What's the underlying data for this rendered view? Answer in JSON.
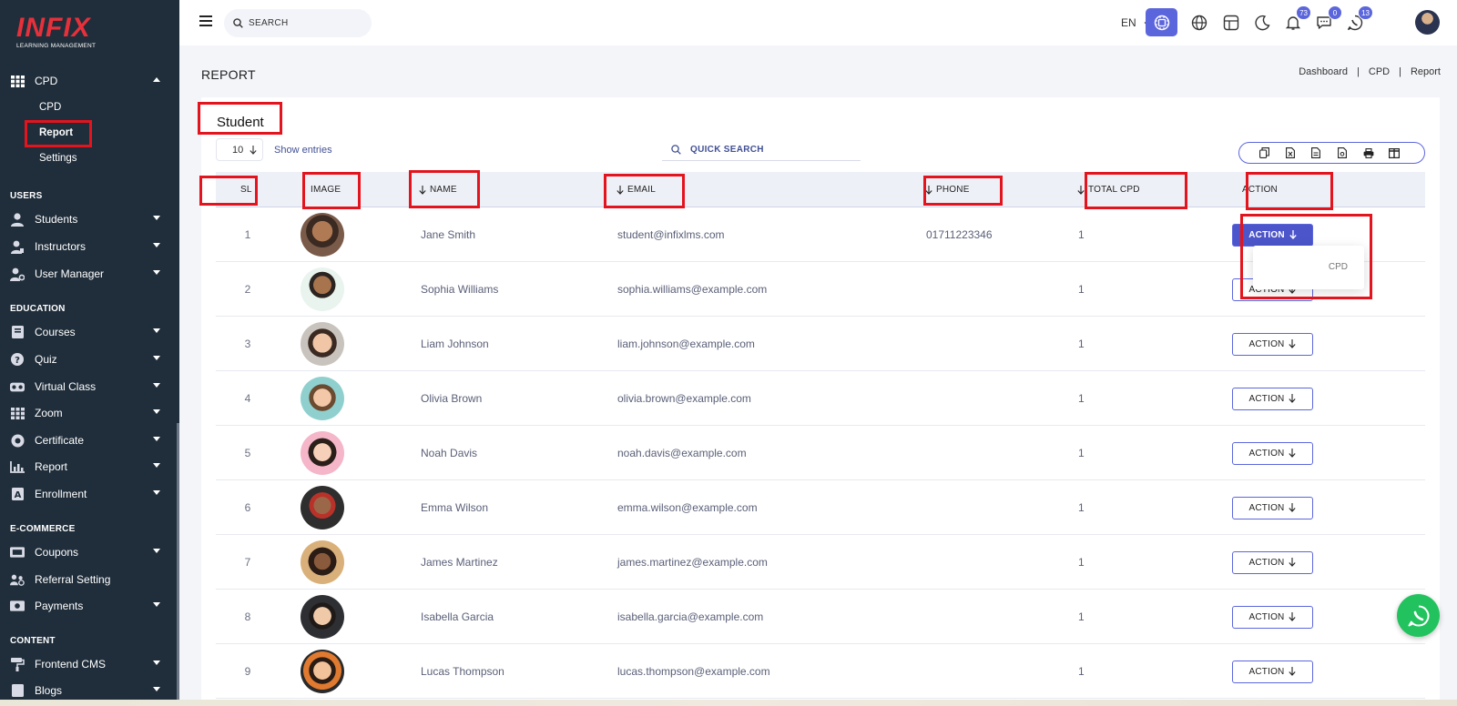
{
  "brand": {
    "name": "INFIX",
    "tagline": "LEARNING MANAGEMENT",
    "accent": "#e8303a",
    "primary": "#5c66dc"
  },
  "sidebar": {
    "open_group": {
      "label": "CPD",
      "icon": "grid-icon"
    },
    "open_group_subitems": [
      {
        "label": "CPD"
      },
      {
        "label": "Report",
        "active": true
      },
      {
        "label": "Settings"
      }
    ],
    "sections": [
      {
        "title": "USERS",
        "items": [
          {
            "label": "Students",
            "icon": "user-icon"
          },
          {
            "label": "Instructors",
            "icon": "instructor-icon"
          },
          {
            "label": "User Manager",
            "icon": "user-gear-icon"
          }
        ]
      },
      {
        "title": "EDUCATION",
        "items": [
          {
            "label": "Courses",
            "icon": "book-icon"
          },
          {
            "label": "Quiz",
            "icon": "question-icon"
          },
          {
            "label": "Virtual Class",
            "icon": "vr-icon"
          },
          {
            "label": "Zoom",
            "icon": "grid-icon"
          },
          {
            "label": "Certificate",
            "icon": "certificate-icon"
          },
          {
            "label": "Report",
            "icon": "chart-icon"
          },
          {
            "label": "Enrollment",
            "icon": "enroll-icon"
          }
        ]
      },
      {
        "title": "E-COMMERCE",
        "items": [
          {
            "label": "Coupons",
            "icon": "coupon-icon"
          },
          {
            "label": "Referral Setting",
            "icon": "referral-icon"
          },
          {
            "label": "Payments",
            "icon": "payment-icon"
          }
        ]
      },
      {
        "title": "CONTENT",
        "items": [
          {
            "label": "Frontend CMS",
            "icon": "paint-roller-icon"
          },
          {
            "label": "Blogs",
            "icon": "blog-icon"
          }
        ]
      }
    ]
  },
  "topbar": {
    "search_placeholder": "SEARCH",
    "language": "EN",
    "badges": {
      "notifications": "73",
      "messages": "0",
      "whatsapp": "13"
    }
  },
  "page": {
    "title": "REPORT",
    "breadcrumb": [
      "Dashboard",
      "CPD",
      "Report"
    ]
  },
  "card": {
    "title": "Student",
    "entries_value": "10",
    "entries_label": "Show entries",
    "quick_search_placeholder": "QUICK SEARCH"
  },
  "table": {
    "headers": {
      "sl": "SL",
      "image": "IMAGE",
      "name": "NAME",
      "email": "EMAIL",
      "phone": "PHONE",
      "total_cpd": "TOTAL CPD",
      "action": "ACTION"
    },
    "action_label": "ACTION",
    "dropdown_option": "CPD",
    "rows": [
      {
        "sl": "1",
        "name": "Jane Smith",
        "email": "student@infixlms.com",
        "phone": "01711223346",
        "total_cpd": "1"
      },
      {
        "sl": "2",
        "name": "Sophia Williams",
        "email": "sophia.williams@example.com",
        "phone": "",
        "total_cpd": "1"
      },
      {
        "sl": "3",
        "name": "Liam Johnson",
        "email": "liam.johnson@example.com",
        "phone": "",
        "total_cpd": "1"
      },
      {
        "sl": "4",
        "name": "Olivia Brown",
        "email": "olivia.brown@example.com",
        "phone": "",
        "total_cpd": "1"
      },
      {
        "sl": "5",
        "name": "Noah Davis",
        "email": "noah.davis@example.com",
        "phone": "",
        "total_cpd": "1"
      },
      {
        "sl": "6",
        "name": "Emma Wilson",
        "email": "emma.wilson@example.com",
        "phone": "",
        "total_cpd": "1"
      },
      {
        "sl": "7",
        "name": "James Martinez",
        "email": "james.martinez@example.com",
        "phone": "",
        "total_cpd": "1"
      },
      {
        "sl": "8",
        "name": "Isabella Garcia",
        "email": "isabella.garcia@example.com",
        "phone": "",
        "total_cpd": "1"
      },
      {
        "sl": "9",
        "name": "Lucas Thompson",
        "email": "lucas.thompson@example.com",
        "phone": "",
        "total_cpd": "1"
      }
    ]
  }
}
